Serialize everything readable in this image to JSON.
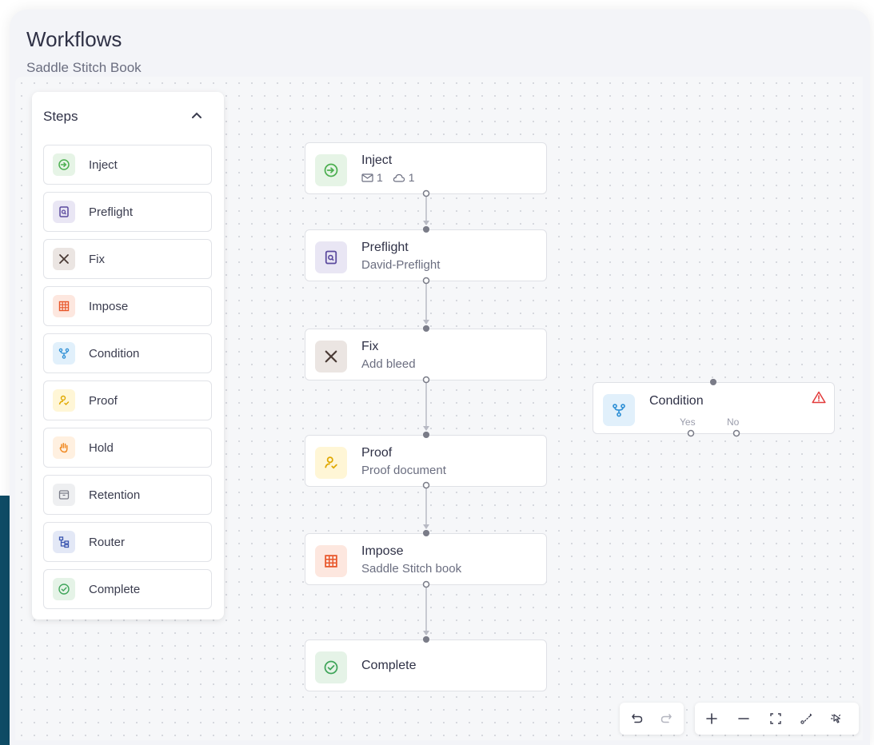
{
  "header": {
    "title": "Workflows",
    "subtitle": "Saddle Stitch Book"
  },
  "steps_panel": {
    "title": "Steps",
    "collapse_icon": "chevron-up-icon",
    "items": [
      {
        "label": "Inject",
        "icon": "inject-icon",
        "color": "#4caf50",
        "bg": "#e6f4e6"
      },
      {
        "label": "Preflight",
        "icon": "preflight-icon",
        "color": "#5b4a9e",
        "bg": "#e9e6f4"
      },
      {
        "label": "Fix",
        "icon": "tools-icon",
        "color": "#4a3a35",
        "bg": "#ebe5e2"
      },
      {
        "label": "Impose",
        "icon": "grid-icon",
        "color": "#e8562a",
        "bg": "#fde7df"
      },
      {
        "label": "Condition",
        "icon": "branch-icon",
        "color": "#2d8fd5",
        "bg": "#e1f0fb"
      },
      {
        "label": "Proof",
        "icon": "proof-icon",
        "color": "#e0a800",
        "bg": "#fff6d6"
      },
      {
        "label": "Hold",
        "icon": "hand-icon",
        "color": "#f08a24",
        "bg": "#fff0e0"
      },
      {
        "label": "Retention",
        "icon": "archive-icon",
        "color": "#7a7c88",
        "bg": "#eeeff1"
      },
      {
        "label": "Router",
        "icon": "router-icon",
        "color": "#3a55b0",
        "bg": "#e3e8f6"
      },
      {
        "label": "Complete",
        "icon": "check-circle-icon",
        "color": "#3fa55a",
        "bg": "#e5f3e7"
      }
    ]
  },
  "flow": {
    "nodes": [
      {
        "title": "Inject",
        "icon": "inject-icon",
        "meta_mail": "1",
        "meta_cloud": "1"
      },
      {
        "title": "Preflight",
        "subtitle": "David-Preflight",
        "icon": "preflight-icon"
      },
      {
        "title": "Fix",
        "subtitle": "Add bleed",
        "icon": "tools-icon"
      },
      {
        "title": "Proof",
        "subtitle": "Proof document",
        "icon": "proof-icon"
      },
      {
        "title": "Impose",
        "subtitle": "Saddle Stitch book",
        "icon": "grid-icon"
      },
      {
        "title": "Complete",
        "icon": "check-circle-icon"
      }
    ],
    "condition": {
      "title": "Condition",
      "icon": "branch-icon",
      "warning_icon": "warning-icon",
      "warning_color": "#e23a3a",
      "yes_label": "Yes",
      "no_label": "No"
    }
  },
  "toolbar": {
    "history": [
      "undo-icon",
      "redo-icon"
    ],
    "view": [
      "zoom-in-icon",
      "zoom-out-icon",
      "fit-view-icon",
      "auto-layout-icon",
      "select-mode-icon"
    ]
  }
}
